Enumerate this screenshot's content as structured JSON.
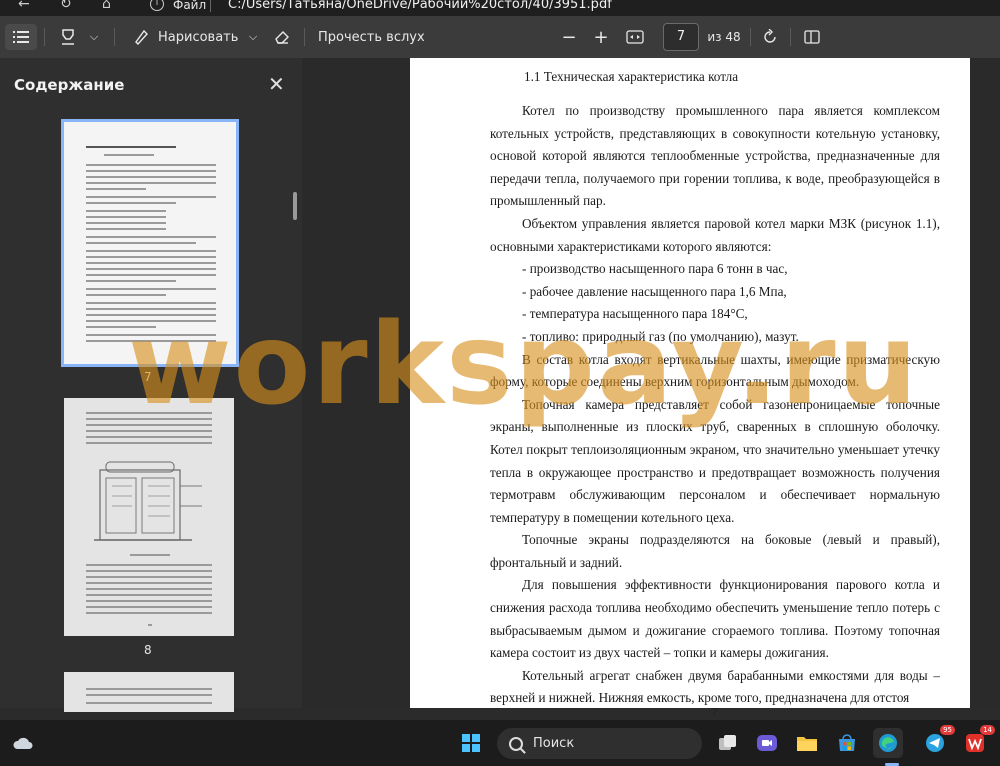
{
  "address_bar": {
    "file_label": "Файл",
    "path": "C:/Users/Татьяна/OneDrive/Рабочий%20стол/40/3951.pdf"
  },
  "toolbar": {
    "draw_label": "Нарисовать",
    "read_aloud_label": "Прочесть вслух",
    "page_current": "7",
    "page_total": "из 48"
  },
  "sidebar": {
    "title": "Содержание",
    "thumbnails": [
      {
        "page": "7"
      },
      {
        "page": "8"
      }
    ]
  },
  "document": {
    "heading": "1.1 Техническая характеристика котла",
    "paragraphs": [
      "Котел по производству промышленного пара является комплексом котельных устройств, представляющих в совокупности котельную установку, основой которой являются теплообменные устройства, предназначенные для передачи тепла, получаемого при горении топлива, к воде, преобразующейся в промышленный пар.",
      "Объектом управления является паровой котел марки МЗК (рисунок 1.1), основными характеристиками которого являются:",
      "- производство насыщенного пара 6 тонн в час,",
      "- рабочее давление насыщенного пара 1,6 Мпа,",
      "- температура насыщенного пара 184°С,",
      "- топливо: природный газ (по умолчанию), мазут.",
      "В состав котла входят вертикальные шахты, имеющие призматическую форму, которые соединены верхним горизонтальным дымоходом.",
      "Топочная камера представляет собой газонепроницаемые топочные экраны, выполненные из плоских труб, сваренных в сплошную оболочку. Котел покрыт теплоизоляционным экраном, что значительно уменьшает утечку тепла в окружающее пространство и предотвращает возможность получения термотравм обслуживающим персоналом и обеспечивает нормальную температуру в помещении котельного цеха.",
      "Топочные экраны подразделяются на боковые (левый и правый), фронтальный и задний.",
      "Для повышения эффективности функционирования парового котла и снижения расхода топлива необходимо обеспечить уменьшение тепло потерь с выбрасываемым дымом и дожигание сгораемого топлива. Поэтому топочная камера состоит из двух частей – топки и камеры дожигания.",
      "Котельный агрегат снабжен двумя барабанными емкостями для воды – верхней и нижней. Нижняя емкость, кроме того, предназначена для отстоя"
    ],
    "page_number": "7"
  },
  "watermark": "workspay.ru",
  "taskbar": {
    "search_label": "Поиск",
    "telegram_badge": "95",
    "office_badge": "14"
  }
}
